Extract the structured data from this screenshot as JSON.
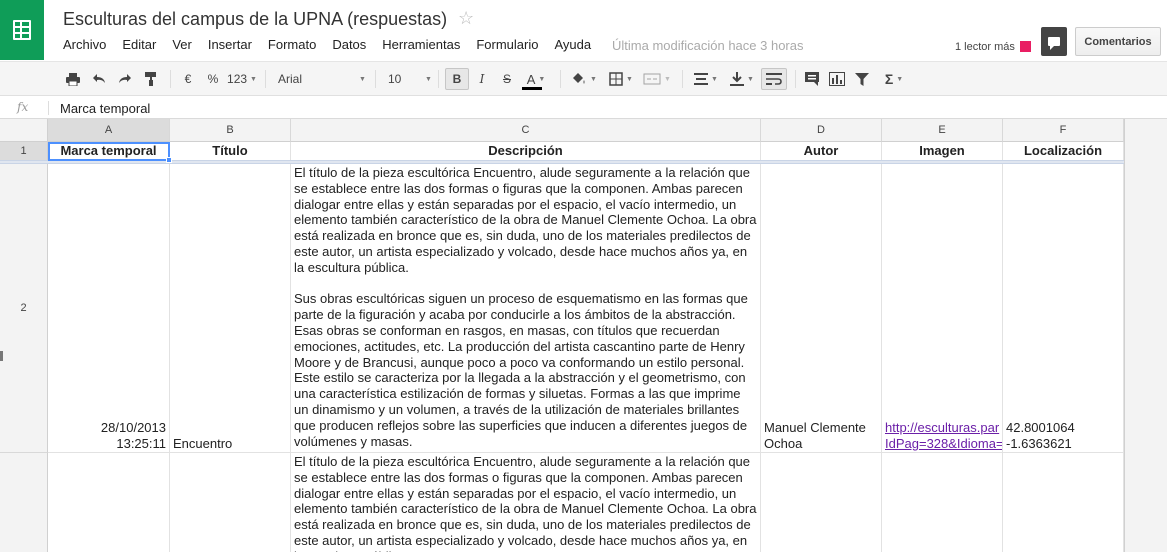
{
  "document": {
    "title": "Esculturas del campus de la UPNA (respuestas)",
    "last_modified": "Última modificación hace 3 horas",
    "viewers": "1 lector más",
    "comments_label": "Comentarios"
  },
  "menu": [
    "Archivo",
    "Editar",
    "Ver",
    "Insertar",
    "Formato",
    "Datos",
    "Herramientas",
    "Formulario",
    "Ayuda"
  ],
  "toolbar": {
    "currency": "€",
    "percent": "%",
    "number_format": "123",
    "font": "Arial",
    "font_size": "10",
    "bold": "B",
    "italic": "I",
    "strike": "S",
    "text_color": "A",
    "functions": "Σ"
  },
  "icons": [
    "print-icon",
    "undo-icon",
    "redo-icon",
    "paint-format-icon",
    "fill-color-icon",
    "borders-icon",
    "merge-icon",
    "align-icon",
    "valign-icon",
    "wrap-icon",
    "comment-icon",
    "chart-icon",
    "filter-icon",
    "star-icon",
    "chat-icon",
    "sheets-logo-icon"
  ],
  "colors": {
    "brand": "#0f9d58",
    "selection": "#4d90fe",
    "viewer": "#e91e63",
    "link": "#6b1fa8"
  },
  "formula_bar": {
    "fx": "fx",
    "value": "Marca temporal"
  },
  "columns": [
    "A",
    "B",
    "C",
    "D",
    "E",
    "F"
  ],
  "rows": [
    "1",
    "2"
  ],
  "headers": [
    "Marca temporal",
    "Título",
    "Descripción",
    "Autor",
    "Imagen",
    "Localización"
  ],
  "row2": {
    "date": "28/10/2013",
    "time": "13:25:11",
    "title": "Encuentro",
    "desc_p1": "El título de la pieza escultórica Encuentro, alude seguramente a la relación que se establece entre las dos formas o figuras que la componen. Ambas parecen dialogar entre ellas y están separadas por el espacio, el vacío intermedio, un elemento también característico de la obra de Manuel Clemente Ochoa. La obra está realizada en bronce que es, sin duda, uno de los materiales predilectos de este autor, un artista especializado y volcado, desde hace muchos años ya, en la escultura pública.",
    "desc_p2": "Sus obras escultóricas siguen un proceso de esquematismo en las formas que parte de la figuración y acaba por conducirle a los ámbitos de la abstracción. Esas obras se conforman en rasgos, en masas, con títulos que recuerdan emociones, actitudes, etc. La producción del artista cascantino parte de Henry Moore y de Brancusi, aunque poco a poco va conformando un estilo personal. Este estilo se caracteriza por la llegada a la abstracción y el geometrismo, con una característica estilización de formas y siluetas. Formas a las que imprime un dinamismo y un volumen, a través de la utilización de materiales brillantes que producen reflejos sobre las superficies que inducen a diferentes juegos de volúmenes y masas.",
    "author": "Manuel Clemente Ochoa",
    "image_line1": "http://esculturas.par",
    "image_line2": "IdPag=328&Idioma=",
    "lat": "42.8001064",
    "lon": "-1.6363621"
  },
  "row3": {
    "desc_p1": "El título de la pieza escultórica Encuentro, alude seguramente a la relación que se establece entre las dos formas o figuras que la componen. Ambas parecen dialogar entre ellas y están separadas por el espacio, el vacío intermedio, un elemento también característico de la obra de Manuel Clemente Ochoa. La obra está realizada en bronce que es, sin duda, uno de los materiales predilectos de este autor, un artista especializado y volcado, desde hace muchos años ya, en la escultura pública."
  }
}
